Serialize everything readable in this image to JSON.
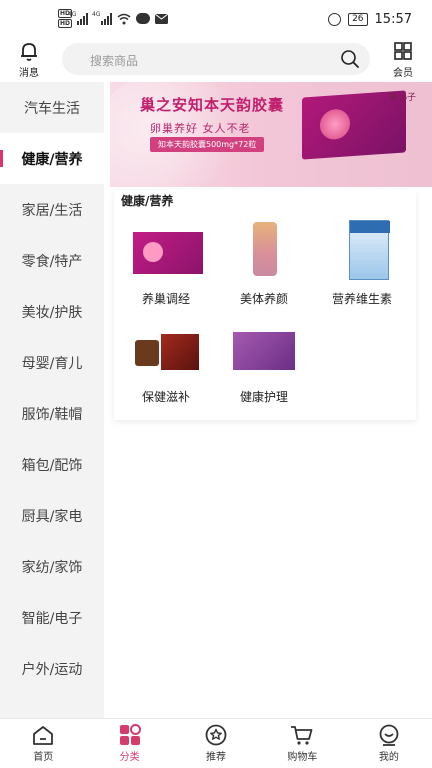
{
  "status_bar": {
    "hd_labels": [
      "HD",
      "HD"
    ],
    "signal_labels": [
      "4G",
      "4G"
    ],
    "battery": "26",
    "time": "15:57"
  },
  "header": {
    "messages_label": "消息",
    "search_placeholder": "搜索商品",
    "vip_label": "会员"
  },
  "sidebar": {
    "items": [
      {
        "label": "汽车生活"
      },
      {
        "label": "健康/营养"
      },
      {
        "label": "家居/生活"
      },
      {
        "label": "零食/特产"
      },
      {
        "label": "美妆/护肤"
      },
      {
        "label": "母婴/育儿"
      },
      {
        "label": "服饰/鞋帽"
      },
      {
        "label": "箱包/配饰"
      },
      {
        "label": "厨具/家电"
      },
      {
        "label": "家纺/家饰"
      },
      {
        "label": "智能/电子"
      },
      {
        "label": "户外/运动"
      }
    ],
    "active_index": 1
  },
  "banner": {
    "title": "巢之安知本天韵胶囊",
    "subtitle": "卵巢养好 女人不老",
    "pill": "知本天韵胶囊500mg*72粒",
    "logo": "果小子"
  },
  "section": {
    "title": "健康/营养",
    "items": [
      {
        "label": "养巢调经"
      },
      {
        "label": "美体养颜"
      },
      {
        "label": "营养维生素"
      },
      {
        "label": "保健滋补"
      },
      {
        "label": "健康护理"
      }
    ]
  },
  "bottom_nav": {
    "items": [
      {
        "label": "首页"
      },
      {
        "label": "分类"
      },
      {
        "label": "推荐"
      },
      {
        "label": "购物车"
      },
      {
        "label": "我的"
      }
    ],
    "active_index": 1
  },
  "colors": {
    "accent": "#d63b6e",
    "sidebar_bg": "#f3f3f3",
    "search_bg": "#f2f2f2"
  }
}
